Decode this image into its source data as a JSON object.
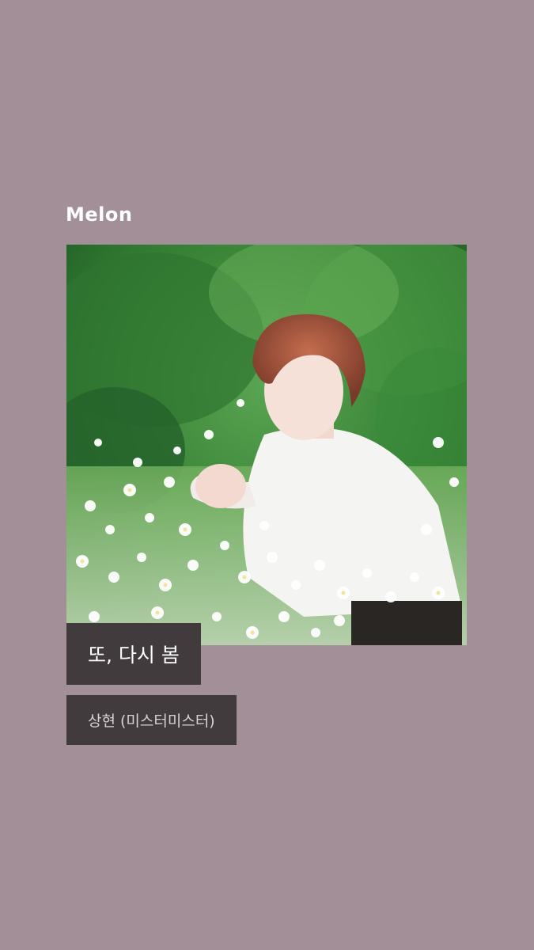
{
  "app": {
    "logo_text": "Melon"
  },
  "track": {
    "title": "또, 다시 봄",
    "artist": "상현 (미스터미스터)"
  },
  "artwork": {
    "description_icon": "album-art-image"
  },
  "colors": {
    "background": "#a38f98",
    "label_box": "#423b3d",
    "logo": "#ffffff"
  }
}
